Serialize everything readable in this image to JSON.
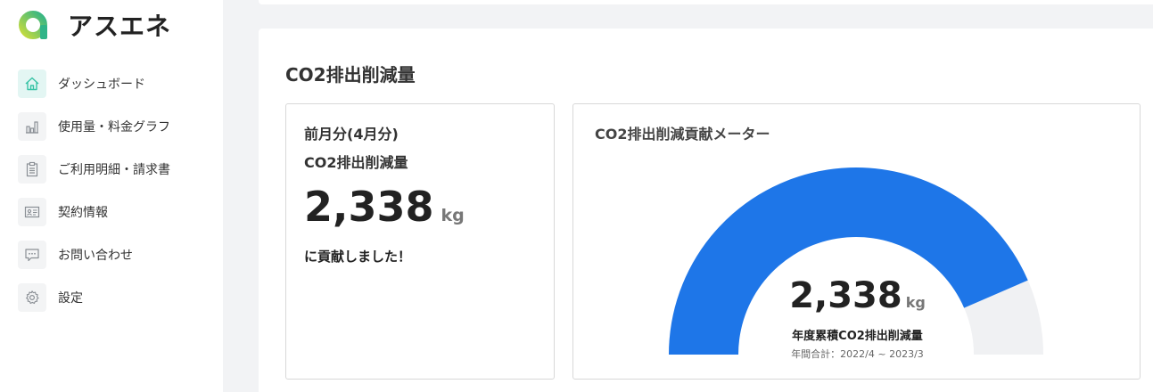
{
  "app": {
    "logo_text": "アスエネ"
  },
  "sidebar": {
    "items": [
      {
        "label": "ダッシュボード",
        "icon": "home-icon",
        "active": true
      },
      {
        "label": "使用量・料金グラフ",
        "icon": "bar-chart-icon",
        "active": false
      },
      {
        "label": "ご利用明細・請求書",
        "icon": "clipboard-icon",
        "active": false
      },
      {
        "label": "契約情報",
        "icon": "id-card-icon",
        "active": false
      },
      {
        "label": "お問い合わせ",
        "icon": "chat-icon",
        "active": false
      },
      {
        "label": "設定",
        "icon": "gear-icon",
        "active": false
      }
    ]
  },
  "main": {
    "title": "CO2排出削減量",
    "monthly_card": {
      "period_label": "前月分(4月分)",
      "metric_label": "CO2排出削減量",
      "value": "2,338",
      "unit": "kg",
      "message": "に貢献しました！"
    },
    "meter_card": {
      "title": "CO2排出削減貢献メーター",
      "value": "2,338",
      "unit": "kg",
      "label": "年度累積CO2排出削減量",
      "period": "年間合計：2022/4 ~ 2023/3",
      "fill_fraction": 0.87
    }
  },
  "colors": {
    "accent": "#1e76e8",
    "gauge_track": "#f0f1f3",
    "logo_green": "#4cbf77",
    "logo_yellow": "#c8dc3c",
    "active_icon": "#37c3a5"
  }
}
